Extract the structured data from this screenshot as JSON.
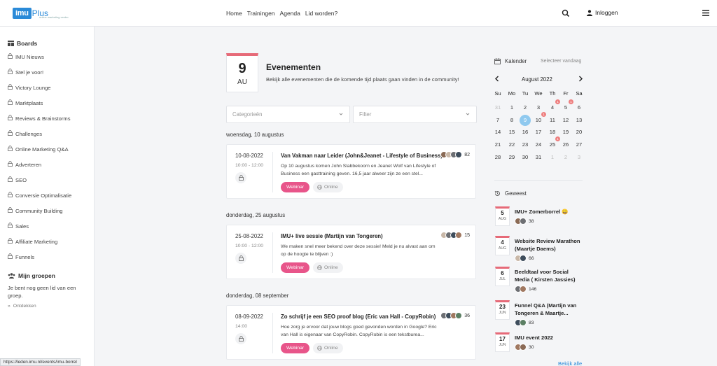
{
  "header": {
    "logo_main": "imu",
    "logo_plus": "Plus",
    "logo_tagline": "online marketing verder",
    "nav": [
      "Home",
      "Trainingen",
      "Agenda",
      "Lid worden?"
    ],
    "login_label": "Inloggen"
  },
  "sidebar": {
    "boards_title": "Boards",
    "items": [
      "IMU Nieuws",
      "Stel je voor!",
      "Victory Lounge",
      "Marktplaats",
      "Reviews & Brainstorms",
      "Challenges",
      "Online Marketing Q&A",
      "Adverteren",
      "SEO",
      "Conversie Optimalisatie",
      "Community Building",
      "Sales",
      "Affiliate Marketing",
      "Funnels"
    ],
    "groups_title": "Mijn groepen",
    "groups_note": "Je bent nog geen lid van een groep.",
    "discover_label": "Ontdekken"
  },
  "main": {
    "date_badge": {
      "day": "9",
      "month": "AU"
    },
    "title": "Evenementen",
    "subtitle": "Bekijk alle evenementen die de komende tijd plaats gaan vinden in de community!",
    "filter_category": "Categorieën",
    "filter_filter": "Filter",
    "groups": [
      {
        "heading": "woensdag, 10 augustus",
        "event": {
          "date": "10-08-2022",
          "time": "10:00 - 12:00",
          "title": "Van Vakman naar Leider (John&Jeanet - Lifestyle of Business)",
          "description": "Op 10 augustus komen John Slabbekoorn en Jeanet Wolf van Lifestyle of Business een gasttraining geven. 16,5 jaar alweer zijn ze een stel...",
          "tag": "Webinar",
          "location": "Online",
          "attendees": "82"
        }
      },
      {
        "heading": "donderdag, 25 augustus",
        "event": {
          "date": "25-08-2022",
          "time": "10:00 - 12:00",
          "title": "IMU+ live sessie (Martijn van Tongeren)",
          "description": "We maken snel meer bekend over deze sessie! Meld je nu alvast aan om op de hoogte te blijven :)",
          "tag": "Webinar",
          "location": "Online",
          "attendees": "15"
        }
      },
      {
        "heading": "donderdag, 08 september",
        "event": {
          "date": "08-09-2022",
          "time": "14:00",
          "title": "Zo schrijf je een SEO proof blog (Eric van Hall - CopyRobin)",
          "description": "Hoe zorg je ervoor dat jouw blogs goed gevonden worden in Google? Eric van Hall is eigenaar van CopyRobin. CopyRobin is een tekstburea...",
          "tag": "Webinar",
          "location": "Online",
          "attendees": "36"
        }
      }
    ]
  },
  "calendar": {
    "title": "Kalender",
    "select_today": "Selecteer vandaag",
    "month_label": "August  2022",
    "weekdays": [
      "Su",
      "Mo",
      "Tu",
      "We",
      "Th",
      "Fr",
      "Sa"
    ],
    "weeks": [
      [
        "31",
        "1",
        "2",
        "3",
        "4",
        "5",
        "6"
      ],
      [
        "7",
        "8",
        "9",
        "10",
        "11",
        "12",
        "13"
      ],
      [
        "14",
        "15",
        "16",
        "17",
        "18",
        "19",
        "20"
      ],
      [
        "21",
        "22",
        "23",
        "24",
        "25",
        "26",
        "27"
      ],
      [
        "28",
        "29",
        "30",
        "31",
        "1",
        "2",
        "3"
      ]
    ],
    "event_marker": "1"
  },
  "past": {
    "title": "Geweest",
    "items": [
      {
        "day": "5",
        "month": "AUG",
        "title": "IMU+ Zomerborrel 😀",
        "count": "38"
      },
      {
        "day": "4",
        "month": "AUG",
        "title": "Website Review Marathon (Maartje Daems)",
        "count": "66"
      },
      {
        "day": "6",
        "month": "JUL",
        "title": "Beeldtaal voor Social Media ( Kirsten Jassies)",
        "count": "146"
      },
      {
        "day": "23",
        "month": "JUN",
        "title": "Funnel Q&A (Martijn van Tongeren & Maartje...",
        "count": "83"
      },
      {
        "day": "17",
        "month": "JUN",
        "title": "IMU event 2022",
        "count": "30"
      }
    ],
    "view_all": "Bekijk alle"
  },
  "statusbar": {
    "url": "https://leden.imu.nl/events/imu-borrel"
  },
  "colors": {
    "accent": "#e8558a",
    "brand": "#2a8ad8",
    "badge_top": "#e66a78",
    "today": "#8fc9ef"
  }
}
